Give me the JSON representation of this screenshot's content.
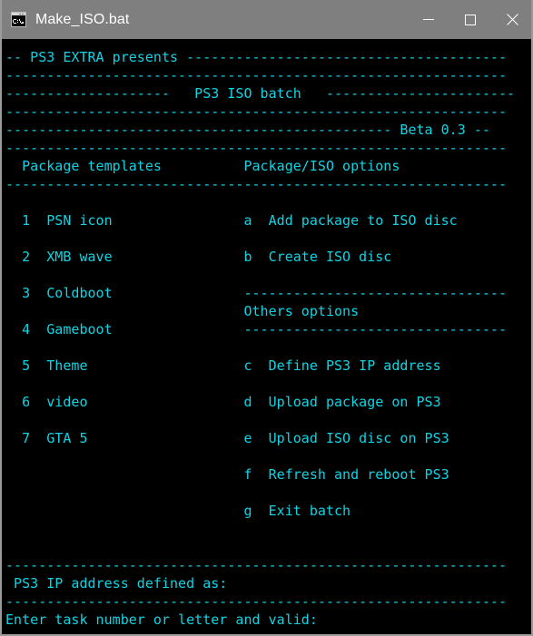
{
  "window": {
    "title": "Make_ISO.bat",
    "icon": "cmd-console-icon",
    "controls": {
      "minimize_label": "Minimize",
      "maximize_label": "Maximize",
      "close_label": "Close"
    },
    "titlebar_color": "#7f7f7f",
    "border_color": "#9a9a9a"
  },
  "console": {
    "background_color": "#000000",
    "text_color": "#0fd4e4",
    "columns": 63,
    "font_size_px": 15,
    "line_height_px": 20,
    "banner": {
      "line1": "-- PS3 EXTRA presents ---------------------------------------",
      "line2": "-------------------------------------------------------------",
      "line3": "--------------------   PS3 ISO batch   -----------------------",
      "line4": "-------------------------------------------------------------",
      "line5": "----------------------------------------------- Beta 0.3 --"
    },
    "headers": {
      "rule_top": "-------------------------------------------------------------",
      "row": " Package templates          Package/ISO options",
      "rule_bottom": "-------------------------------------------------------------",
      "left_title": "Package templates",
      "right_title": "Package/ISO options"
    },
    "left_menu": [
      {
        "key": "1",
        "label": "PSN icon"
      },
      {
        "key": "2",
        "label": "XMB wave"
      },
      {
        "key": "3",
        "label": "Coldboot"
      },
      {
        "key": "4",
        "label": "Gameboot"
      },
      {
        "key": "5",
        "label": "Theme"
      },
      {
        "key": "6",
        "label": "video"
      },
      {
        "key": "7",
        "label": "GTA 5"
      }
    ],
    "right_menu_package": [
      {
        "key": "a",
        "label": "Add package to ISO disc"
      },
      {
        "key": "b",
        "label": "Create ISO disc"
      }
    ],
    "others_section": {
      "rule_top": "--------------------------------",
      "title": "Others options",
      "rule_bottom": "--------------------------------"
    },
    "right_menu_others": [
      {
        "key": "c",
        "label": "Define PS3 IP address"
      },
      {
        "key": "d",
        "label": "Upload package on PS3"
      },
      {
        "key": "e",
        "label": "Upload ISO disc on PS3"
      },
      {
        "key": "f",
        "label": "Refresh and reboot PS3"
      },
      {
        "key": "g",
        "label": "Exit batch"
      }
    ],
    "footer": {
      "rule_top": "-------------------------------------------------------------",
      "ip_status": " PS3 IP address defined as:",
      "rule_bottom": "-------------------------------------------------------------",
      "prompt": "Enter task number or letter and valid:"
    },
    "body_lines": [
      "-- PS3 EXTRA presents ---------------------------------------",
      "-------------------------------------------------------------",
      "--------------------   PS3 ISO batch   -----------------------",
      "-------------------------------------------------------------",
      "----------------------------------------------- Beta 0.3 --",
      "-------------------------------------------------------------",
      "  Package templates          Package/ISO options",
      "-------------------------------------------------------------",
      "",
      "  1  PSN icon                a  Add package to ISO disc",
      "",
      "  2  XMB wave                b  Create ISO disc",
      "",
      "  3  Coldboot                --------------------------------",
      "                             Others options",
      "  4  Gameboot                --------------------------------",
      "",
      "  5  Theme                   c  Define PS3 IP address",
      "",
      "  6  video                   d  Upload package on PS3",
      "",
      "  7  GTA 5                   e  Upload ISO disc on PS3",
      "",
      "                             f  Refresh and reboot PS3",
      "",
      "                             g  Exit batch",
      "",
      "",
      "-------------------------------------------------------------",
      " PS3 IP address defined as:",
      "-------------------------------------------------------------",
      "Enter task number or letter and valid:"
    ]
  }
}
